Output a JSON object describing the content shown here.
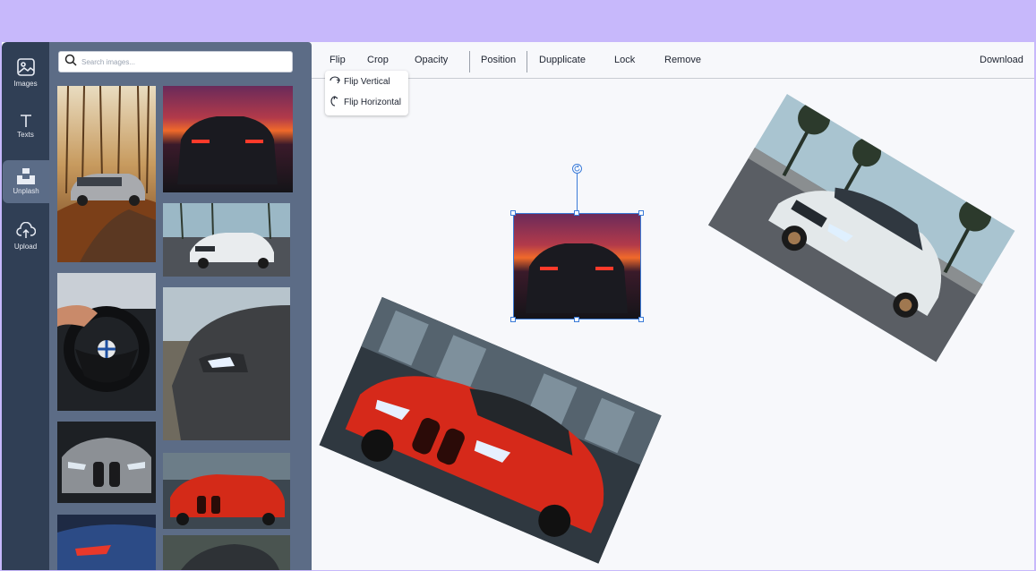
{
  "rail": {
    "items": [
      {
        "label": "Images",
        "icon": "image-icon"
      },
      {
        "label": "Texts",
        "icon": "text-icon"
      },
      {
        "label": "Unplash",
        "icon": "unsplash-icon"
      },
      {
        "label": "Upload",
        "icon": "upload-icon"
      }
    ],
    "active": "Unplash"
  },
  "panel": {
    "search_placeholder": "Search images..."
  },
  "toolbar": {
    "flip": "Flip",
    "crop": "Crop",
    "opacity": "Opacity",
    "position": "Position",
    "duplicate": "Dupplicate",
    "lock": "Lock",
    "remove": "Remove",
    "download": "Download"
  },
  "flip_menu": {
    "vertical": "Flip Vertical",
    "horizontal": "Flip Horizontal"
  },
  "colors": {
    "top_band": "#c7b8fb",
    "rail": "#303f55",
    "panel": "#5c6c86",
    "selection": "#3b7bd8"
  }
}
